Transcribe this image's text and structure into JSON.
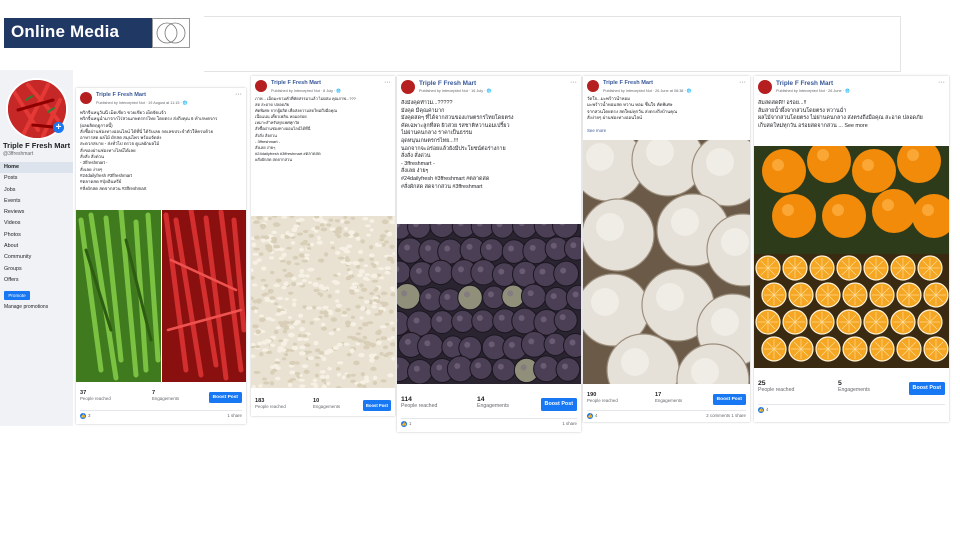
{
  "slide": {
    "title": "Online Media"
  },
  "page": {
    "name": "Triple F Fresh Mart",
    "handle": "@3ffreshmart",
    "nav": [
      "Home",
      "Posts",
      "Jobs",
      "Events",
      "Reviews",
      "Videos",
      "Photos",
      "About",
      "Community",
      "Groups",
      "Offers"
    ],
    "active_nav": "Home",
    "promote_label": "Promote",
    "manage_label": "Manage promotions"
  },
  "posts": [
    {
      "author": "Triple F Fresh Mart",
      "meta": "Published by Intercepted Nut · 19 August at 11:15 · 🌐",
      "text": "พริกจิ้นหนูวันนี้ เม็ดเขียว ขวยเขียว เผ็ดจัดแจ้ว\nพริกจิ้นหนูนำมาจากไร่สวนเกษตรกรไทย โดยตรง ส่งถึงคุณ 6 ทำเกษตรกร\n(ผลผลิตฤดูกาลนี้)\nสั่งชื้อผ่านช่องทางออนไลน์ ได้ที่นี่ ได้รับเลย กดเลขประจำตัวให้ครบด้วย\nอาหารสด ผลไม้ ผักสด สมุนไพร พร้อมจัดส่ง\nสะดวกสบาย - ส่งทั่วไป ตรวจ ดูแลผักผลไม้\nสั่งของผ่านช่องทางไลน์ได้เลย\nสั่งสั่ง สั่งด่วน\n- 3ffreshmart -\nสั่งเลย ง่ายๆ\n#24dailyfresh #3ffreshmart\n#ตลาดสด #ปุ๋ยอินทรีย์\n#สั่งผักสด สดจากสวน #3ffreshmart",
      "reached": "37",
      "reached_label": "People reached",
      "engagements": "7",
      "engagements_label": "Engagements",
      "boost_label": "Boost Post",
      "likes": "3",
      "shares": "1 share",
      "image": "chili"
    },
    {
      "author": "Triple F Fresh Mart",
      "meta": "Published by Intercepted Nut · 8 July · 🌐",
      "text": "ภาพ... เม็ดมะขามคั่วที่คัดสรรมาแล้ว ไม่ผสม คุณภาพ...???\nสด สะอาด ปลอดภัย\nคัดพิเศษ จากผู้ผลิต เพื่อส่งความสดใหม่ถึงมือคุณ\nเนื้อแน่น เคี้ยวเพลิน หอมอร่อย\nเหมาะสำหรับทุกเพศทุกวัย\nสั่งซื้อผ่านช่องทางออนไลน์ได้ที่นี่\nสั่งสั่ง สั่งด่วน\n- 3ffreshmart -\nสั่งเลย ง่ายๆ\n#24dailyfresh #3ffreshmart #ตลาดสด\n#สั่งผักสด สดจากสวน",
      "reached": "183",
      "reached_label": "People reached",
      "engagements": "10",
      "engagements_label": "Engagements",
      "boost_label": "Boost Post",
      "likes": "",
      "shares": "",
      "image": "seeds"
    },
    {
      "author": "Triple F Fresh Mart",
      "meta": "Published by Intercepted Nut · 16 July · 🌐",
      "text": "สั่งมังคุดทำไม...?????\nมังคุด มีคุณค่ามาก\nมังคุดสดๆ ที่ได้จากสวนของเกษตรกรไทยโดยตรง\nคัดเฉพาะลูกที่สด ผิวสวย รสชาติหวานอมเปรี้ยว\nไม่ผ่านคนกลาง ราคาเป็นธรรม\nอุดหนุนเกษตรกรไทย...!!!\nนอกจากจะอร่อยแล้วยังมีประโยชน์ต่อร่างกาย\nสั่งสั่ง สั่งด่วน\n- 3ffreshmart -\nสั่งเลย ง่ายๆ\n#24dailyfresh #3ffreshmart #ตลาดสด\n#สั่งผักสด สดจากสวน #3ffreshmart",
      "reached": "114",
      "reached_label": "People reached",
      "engagements": "14",
      "engagements_label": "Engagements",
      "boost_label": "Boost Post",
      "likes": "1",
      "shares": "1 share",
      "image": "mangosteen"
    },
    {
      "author": "Triple F Fresh Mart",
      "meta": "Published by Intercepted Nut · 26 June at 08:38 · 🌐",
      "text": "วัดใจ...มะพร้าวน้ำหอม\nมะพร้าวน้ำหอมสด หวาน หอม ชื่นใจ คัดพิเศษ\nจากสวนโดยตรง สดใหม่ทุกวัน ส่งตรงถึงบ้านคุณ\nสั่งง่ายๆ ผ่านช่องทางออนไลน์",
      "see_more": "See more",
      "reached": "190",
      "reached_label": "People reached",
      "engagements": "17",
      "engagements_label": "Engagements",
      "boost_label": "Boost Post",
      "likes": "4",
      "shares": "2 comments 1 share",
      "image": "coconut"
    },
    {
      "author": "Triple F Fresh Mart",
      "meta": "Published by Intercepted Nut · 26 June · 🌐",
      "text": "ส้มสดสดดี!! อร่อย...!!\nส้มสายน้ำผึ้งจากสวนโดยตรง หวานฉ่ำ\nผลไม้จากสวนโดยตรง ไม่ผ่านคนกลาง ส่งตรงถึงมือคุณ สะอาด ปลอดภัย\nเก็บสดใหม่ทุกวัน อร่อยสดจากสวน ... See more",
      "reached": "25",
      "reached_label": "People reached",
      "engagements": "5",
      "engagements_label": "Engagements",
      "boost_label": "Boost Post",
      "likes": "4",
      "shares": "",
      "image": "orange"
    }
  ],
  "colors": {
    "brand_blue": "#1877f2",
    "title_bar": "#1f3864",
    "link": "#385898"
  }
}
